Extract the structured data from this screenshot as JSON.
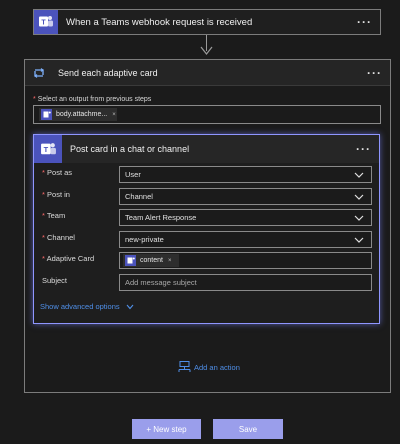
{
  "trigger": {
    "title": "When a Teams webhook request is received",
    "menu": "···"
  },
  "loop": {
    "title": "Send each adaptive card",
    "menu": "···",
    "output_required_mark": "*",
    "output_label": "Select an output from previous steps",
    "output_token": "body.attachme...",
    "token_remove": "×"
  },
  "action": {
    "title": "Post card in a chat or channel",
    "menu": "···",
    "fields": [
      {
        "label": "Post as",
        "required": "*",
        "value": "User",
        "type": "dropdown"
      },
      {
        "label": "Post in",
        "required": "*",
        "value": "Channel",
        "type": "dropdown"
      },
      {
        "label": "Team",
        "required": "*",
        "value": "Team Alert Response",
        "type": "dropdown"
      },
      {
        "label": "Channel",
        "required": "*",
        "value": "new-private",
        "type": "dropdown"
      },
      {
        "label": "Adaptive Card",
        "required": "*",
        "value": "content",
        "type": "token"
      },
      {
        "label": "Subject",
        "required": "",
        "placeholder": "Add message subject",
        "type": "text"
      }
    ],
    "advanced_link": "Show advanced options"
  },
  "add_action": "Add an action",
  "buttons": {
    "new_step": "+ New step",
    "save": "Save"
  },
  "colors": {
    "teams": "#4b53bc",
    "link": "#4f8fe8",
    "focus_border": "#8f96ff",
    "button": "#9a9eeb",
    "required": "#ff6b6b"
  },
  "icons": {
    "teams": "teams-icon",
    "loop": "loop-icon",
    "chevron": "chevron-down-icon",
    "add_action": "add-action-icon"
  }
}
